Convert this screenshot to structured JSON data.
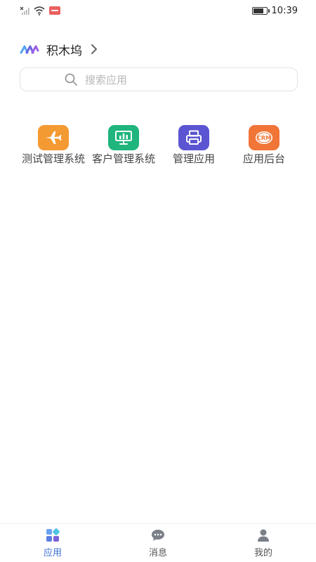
{
  "status_bar": {
    "time": "10:39",
    "icons": [
      "signal-icon",
      "wifi-icon",
      "notification-badge-icon",
      "battery-icon"
    ]
  },
  "header": {
    "org_name": "积木坞",
    "icons": [
      "org-logo-icon",
      "chevron-right-icon"
    ]
  },
  "search": {
    "placeholder": "搜索应用",
    "icon": "search-icon"
  },
  "apps": [
    {
      "label": "测试管理系统",
      "icon": "airplane-icon",
      "color": "#f49a32"
    },
    {
      "label": "客户管理系统",
      "icon": "monitor-chart-icon",
      "color": "#1fb57c"
    },
    {
      "label": "管理应用",
      "icon": "printer-icon",
      "color": "#5b55d2"
    },
    {
      "label": "应用后台",
      "icon": "crm-icon",
      "color": "#f07537",
      "badge_text": "CRM"
    }
  ],
  "bottom_nav": {
    "active_color": "#3b6fd6",
    "items": [
      {
        "label": "应用",
        "icon": "apps-grid-icon",
        "active": true
      },
      {
        "label": "消息",
        "icon": "chat-bubble-icon",
        "active": false
      },
      {
        "label": "我的",
        "icon": "person-icon",
        "active": false
      }
    ]
  }
}
